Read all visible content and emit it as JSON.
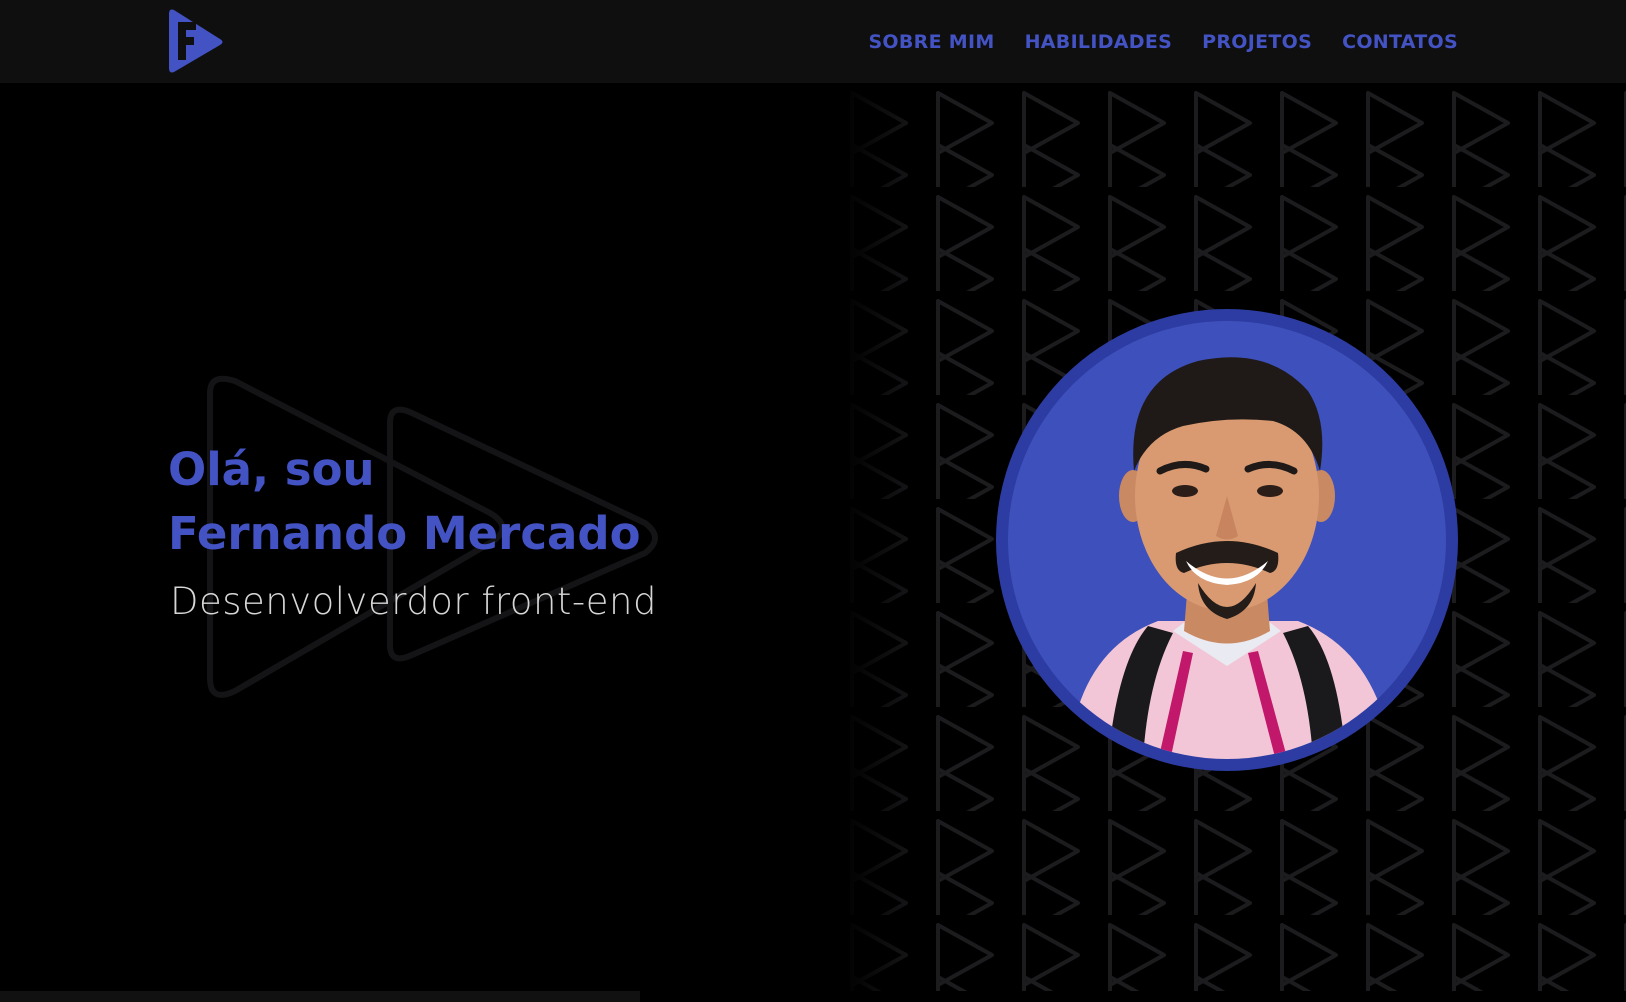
{
  "nav": {
    "logo_icon": "brand-play-f-logo",
    "links": [
      {
        "label": "SOBRE MIM"
      },
      {
        "label": "HABILIDADES"
      },
      {
        "label": "PROJETOS"
      },
      {
        "label": "CONTATOS"
      }
    ]
  },
  "hero": {
    "greeting": "Olá, sou",
    "name": "Fernando Mercado",
    "role": "Desenvolverdor front-end"
  },
  "colors": {
    "accent": "#4353c4",
    "navbar_bg": "#0f0f10",
    "page_bg": "#000000",
    "avatar_ring": "#2d3ca3",
    "avatar_bg": "#3e50bc",
    "role_text": "#d6d6d6"
  }
}
